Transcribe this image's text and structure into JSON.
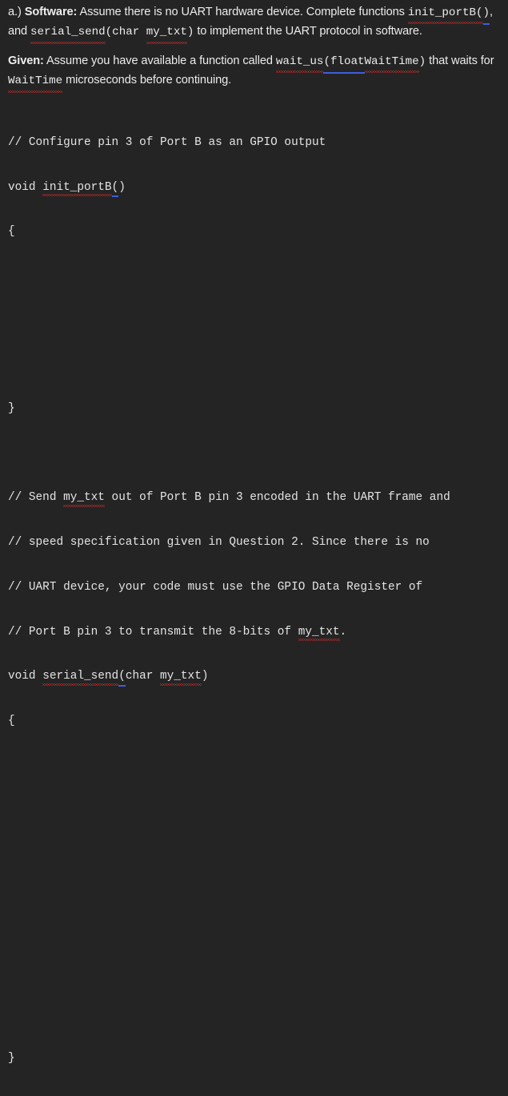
{
  "document": {
    "background_color": "#242424",
    "text_color": "#e9e9e9",
    "spellcheck_underline_color": "#e22b2b",
    "grammar_underline_color": "#3c5fe0"
  },
  "paragraphs": {
    "problem": {
      "label": "a.)",
      "bold_label": "Software:",
      "seg1": " Assume there is no UART hardware device.  Complete functions ",
      "code1": "init_portB(",
      "code1_tail": ")",
      "seg2": ", and ",
      "code2": "serial_send",
      "code2_tail": "(char ",
      "code3": "my_txt",
      "code3_tail": ")",
      "seg3": " to implement the UART protocol in software."
    },
    "given": {
      "bold_label": "Given:",
      "seg1": "  Assume you have available a function called ",
      "code1": "wait_us",
      "code1_tail": "(float ",
      "code2": "WaitTime",
      "code2_tail": ")",
      "seg2": " that waits for ",
      "code3": "WaitTime",
      "seg3": " microseconds before continuing."
    }
  },
  "code_block_1": {
    "comment_1": "// Configure pin 3 of Port B as an GPIO output",
    "signature_prefix": "void ",
    "signature_name": "init_portB",
    "signature_open": "(",
    "signature_close": ")",
    "open_brace": "{",
    "close_brace": "}"
  },
  "code_block_2": {
    "comment_1_a": "// Send ",
    "comment_1_b": "my_txt",
    "comment_1_c": " out of Port B pin 3 encoded in the UART frame and",
    "comment_2": "// speed specification given in Question 2. Since there is no",
    "comment_3": "// UART device, your code must use the GPIO Data Register of",
    "comment_4_a": "// Port B pin 3 to transmit the 8-bits of ",
    "comment_4_b": "my_txt",
    "comment_4_c": ".",
    "signature_prefix": "void ",
    "signature_name": "serial_send",
    "signature_open": "(",
    "signature_args_prefix": "char ",
    "signature_args_name": "my_txt",
    "signature_close": ")",
    "open_brace": "{",
    "close_brace": "}"
  }
}
